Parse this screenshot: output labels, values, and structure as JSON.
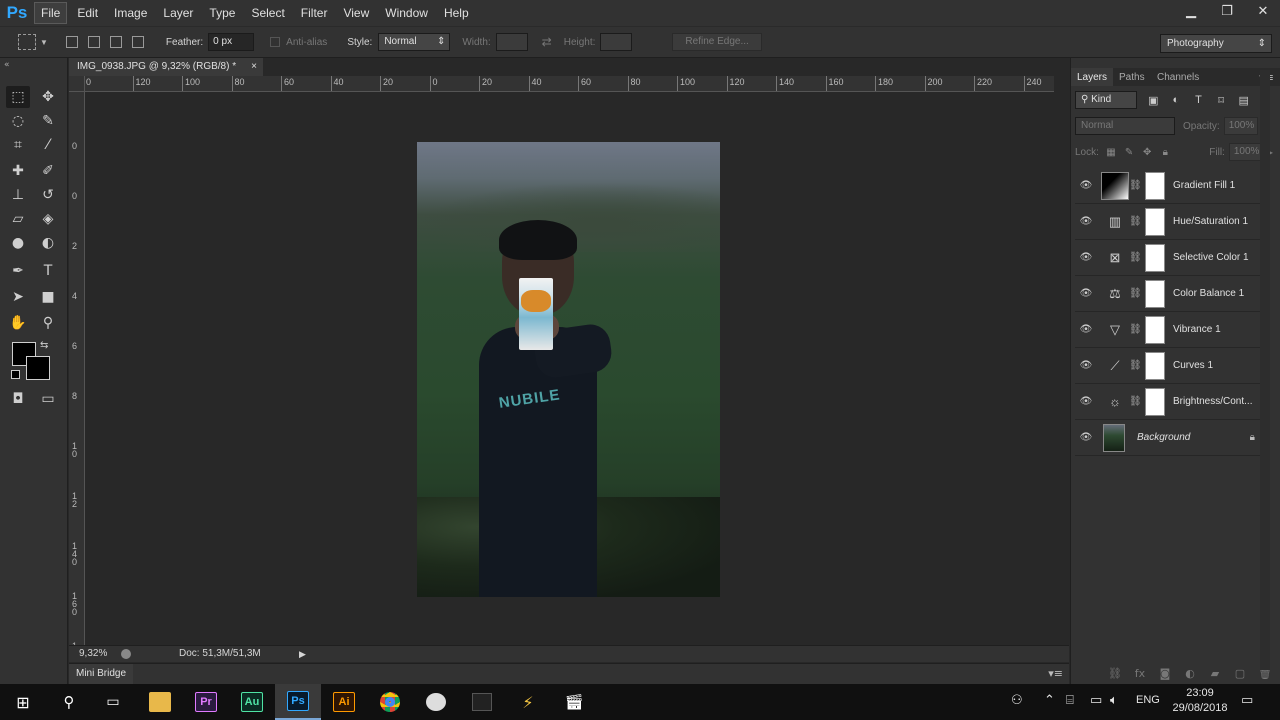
{
  "app": {
    "logo_text": "Ps",
    "menu": [
      "File",
      "Edit",
      "Image",
      "Layer",
      "Type",
      "Select",
      "Filter",
      "View",
      "Window",
      "Help"
    ],
    "window_controls": [
      "minimize",
      "restore",
      "close"
    ]
  },
  "options_bar": {
    "feather_label": "Feather:",
    "feather_value": "0 px",
    "antialias_label": "Anti-alias",
    "style_label": "Style:",
    "style_value": "Normal",
    "width_label": "Width:",
    "height_label": "Height:",
    "refine_edge_label": "Refine Edge...",
    "workspace_value": "Photography"
  },
  "document": {
    "tab_title": "IMG_0938.JPG @ 9,32% (RGB/8) *",
    "tab_close": "×",
    "ruler_top_labels": [
      "0",
      "120",
      "100",
      "80",
      "60",
      "40",
      "20",
      "0",
      "20",
      "40",
      "60",
      "80",
      "100",
      "120",
      "140",
      "160",
      "180",
      "200",
      "220",
      "240"
    ],
    "ruler_left_labels": [
      "0",
      "0",
      "2",
      "4",
      "6",
      "8",
      "10",
      "12",
      "140",
      "160",
      "180",
      "2"
    ],
    "photo_print_text": "NUBILE"
  },
  "status": {
    "zoom": "9,32%",
    "doc_info": "Doc: 51,3M/51,3M"
  },
  "mini_bridge": {
    "label": "Mini Bridge"
  },
  "layers_panel": {
    "tabs": [
      "Layers",
      "Paths",
      "Channels"
    ],
    "filter_kind": "Kind",
    "blend_mode": "Normal",
    "opacity_label": "Opacity:",
    "opacity_value": "100%",
    "lock_label": "Lock:",
    "fill_label": "Fill:",
    "fill_value": "100%",
    "layers": [
      {
        "name": "Gradient Fill 1",
        "icon": "gradient-thumb"
      },
      {
        "name": "Hue/Saturation 1",
        "icon": "hue-saturation-icon"
      },
      {
        "name": "Selective Color 1",
        "icon": "selective-color-icon"
      },
      {
        "name": "Color Balance 1",
        "icon": "color-balance-icon"
      },
      {
        "name": "Vibrance 1",
        "icon": "vibrance-icon"
      },
      {
        "name": "Curves 1",
        "icon": "curves-icon"
      },
      {
        "name": "Brightness/Cont...",
        "icon": "brightness-contrast-icon"
      },
      {
        "name": "Background",
        "icon": "photo-thumb"
      }
    ]
  },
  "taskbar": {
    "language": "ENG",
    "time": "23:09",
    "date": "29/08/2018",
    "apps": [
      {
        "name": "file-explorer",
        "label": ""
      },
      {
        "name": "premiere",
        "label": "Pr"
      },
      {
        "name": "audition",
        "label": "Au"
      },
      {
        "name": "photoshop",
        "label": "Ps"
      },
      {
        "name": "illustrator",
        "label": "Ai"
      }
    ]
  },
  "colors": {
    "ps_blue": "#31a8ff",
    "premiere": "#2a1b3f",
    "premiere_text": "#e07aff",
    "audition": "#0b2b22",
    "audition_text": "#4fe3a4",
    "photoshop": "#071a2b",
    "photoshop_text": "#31a8ff",
    "illustrator": "#2e1503",
    "illustrator_text": "#ff9a00"
  }
}
